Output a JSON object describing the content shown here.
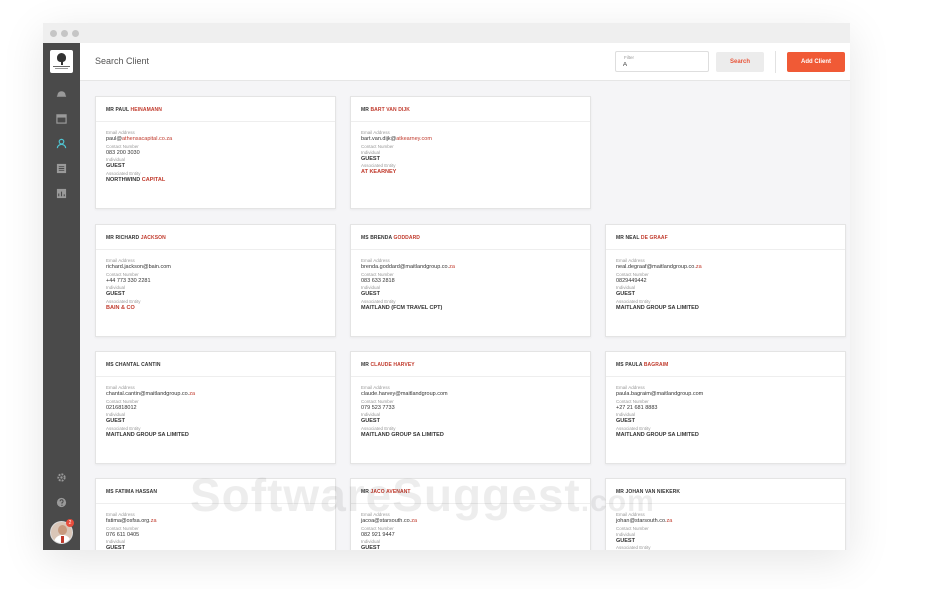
{
  "window": {
    "title": ""
  },
  "header": {
    "title": "Search Client",
    "filter_label": "Filter",
    "filter_value": "A",
    "search_label": "Search",
    "add_label": "Add Client"
  },
  "sidebar": {
    "items": [
      {
        "icon": "hotel-bell-icon"
      },
      {
        "icon": "calendar-icon"
      },
      {
        "icon": "user-icon",
        "active": true
      },
      {
        "icon": "list-icon"
      },
      {
        "icon": "chart-icon"
      }
    ],
    "bottom": [
      {
        "icon": "gear-icon"
      },
      {
        "icon": "help-icon"
      }
    ],
    "notification_count": "2"
  },
  "labels": {
    "email": "Email Address",
    "contact": "Contact Number",
    "individual": "Individual",
    "entity": "Associated Entity"
  },
  "clients": [
    {
      "name_a": "MR PAUL ",
      "name_b": "HEINAMANN",
      "email_a": "paul@",
      "email_b": "athensacapital.co.za",
      "phone": "083 200 3030",
      "type": "GUEST",
      "entity_a": "NORTHWIND ",
      "entity_b": "CAPITAL"
    },
    {
      "name_a": "MR ",
      "name_b": "BART VAN DIJK",
      "email_a": "bart.van.dijk@",
      "email_b": "atkearney.com",
      "phone": "",
      "type": "GUEST",
      "entity_a": "",
      "entity_b": "AT KEARNEY"
    },
    {
      "name_a": "MR RICHARD ",
      "name_b": "JACKSON",
      "email_a": "richard.jackson@bain.com",
      "email_b": "",
      "phone": "+44 773 330 2281",
      "type": "GUEST",
      "entity_a": "",
      "entity_b": "BAIN & CO"
    },
    {
      "name_a": "MS BRENDA ",
      "name_b": "GODDARD",
      "email_a": "brenda.goddard@maitlandgroup.co.",
      "email_b": "za",
      "phone": "083 633 2818",
      "type": "GUEST",
      "entity_a": "MAITLAND (FCM TRAVEL CPT)",
      "entity_b": ""
    },
    {
      "name_a": "MR NEAL ",
      "name_b": "DE GRAAF",
      "email_a": "neal.degraaf@maitlandgroup.co.",
      "email_b": "za",
      "phone": "0829449442",
      "type": "GUEST",
      "entity_a": "MAITLAND GROUP SA LIMITED",
      "entity_b": ""
    },
    {
      "name_a": "MS CHANTAL CANTIN",
      "name_b": "",
      "email_a": "chantal.cantin@maitlandgroup.co.",
      "email_b": "za",
      "phone": "0216818012",
      "type": "GUEST",
      "entity_a": "MAITLAND GROUP SA LIMITED",
      "entity_b": ""
    },
    {
      "name_a": "MR ",
      "name_b": "CLAUDE HARVEY",
      "email_a": "claude.harvey@maitlandgroup.com",
      "email_b": "",
      "phone": "079 523 7733",
      "type": "GUEST",
      "entity_a": "MAITLAND GROUP SA LIMITED",
      "entity_b": ""
    },
    {
      "name_a": "MS PAULA ",
      "name_b": "BAGRAIM",
      "email_a": "paula.bagraim@maitlandgroup.com",
      "email_b": "",
      "phone": "+27 21 681 8883",
      "type": "GUEST",
      "entity_a": "MAITLAND GROUP SA LIMITED",
      "entity_b": ""
    },
    {
      "name_a": "MS FATIMA HASSAN",
      "name_b": "",
      "email_a": "fatima@osfsa.org.",
      "email_b": "za",
      "phone": "076 611 0405",
      "type": "GUEST",
      "entity_a": "",
      "entity_b": ""
    },
    {
      "name_a": "MR ",
      "name_b": "JACO AVENANT",
      "email_a": "jacoa@starsouth.co.",
      "email_b": "za",
      "phone": "082 921 9447",
      "type": "GUEST",
      "entity_a": "",
      "entity_b": ""
    },
    {
      "name_a": "MR JOHAN VAN NIEKERK",
      "name_b": "",
      "email_a": "johan@starsouth.co.",
      "email_b": "za",
      "phone": "",
      "type": "GUEST",
      "entity_a": "",
      "entity_b": ""
    }
  ],
  "watermark": {
    "main": "SoftwareSuggest",
    "suffix": ".com"
  },
  "colors": {
    "accent": "#f05a36",
    "highlight": "#c0392b",
    "sidebar": "#4a4a4a"
  }
}
